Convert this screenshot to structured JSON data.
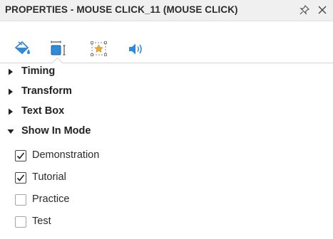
{
  "panel": {
    "title": "PROPERTIES - MOUSE CLICK_11 (MOUSE CLICK)",
    "pin_icon": "pin-icon",
    "close_icon": "close-icon"
  },
  "tabs": [
    {
      "icon": "paint-bucket-icon",
      "name": "Fill"
    },
    {
      "icon": "size-position-icon",
      "name": "Size and Position",
      "active": true
    },
    {
      "icon": "star-frame-icon",
      "name": "Effects"
    },
    {
      "icon": "speaker-icon",
      "name": "Audio"
    }
  ],
  "sections": [
    {
      "label": "Timing",
      "expanded": false
    },
    {
      "label": "Transform",
      "expanded": false
    },
    {
      "label": "Text Box",
      "expanded": false
    },
    {
      "label": "Show In Mode",
      "expanded": true
    }
  ],
  "modes": [
    {
      "label": "Demonstration",
      "checked": true
    },
    {
      "label": "Tutorial",
      "checked": true
    },
    {
      "label": "Practice",
      "checked": false
    },
    {
      "label": "Test",
      "checked": false
    }
  ],
  "colors": {
    "accent": "#2f8ad8",
    "star": "#f0a830"
  }
}
